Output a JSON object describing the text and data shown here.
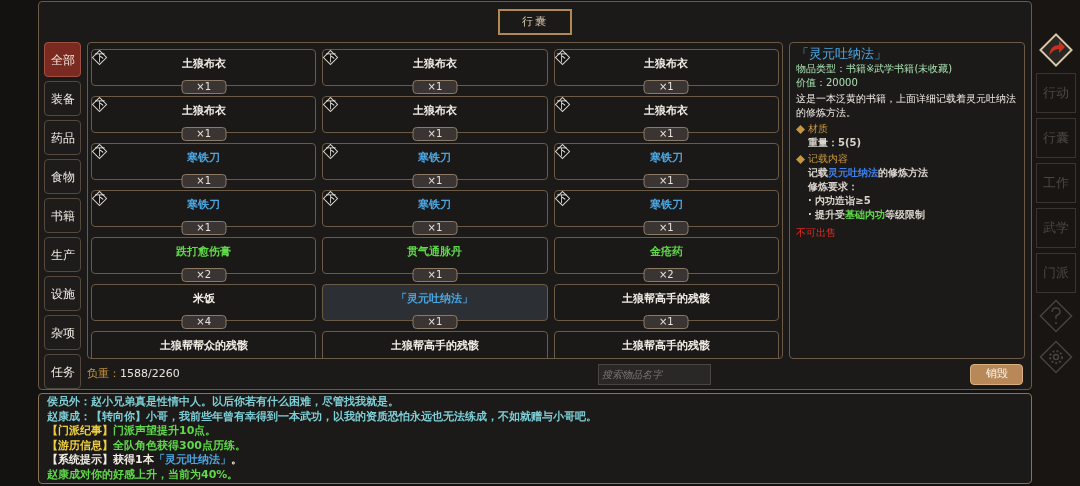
{
  "title": "行囊",
  "categories": [
    {
      "label": "全部",
      "selected": true
    },
    {
      "label": "装备",
      "selected": false
    },
    {
      "label": "药品",
      "selected": false
    },
    {
      "label": "食物",
      "selected": false
    },
    {
      "label": "书籍",
      "selected": false
    },
    {
      "label": "生产",
      "selected": false
    },
    {
      "label": "设施",
      "selected": false
    },
    {
      "label": "杂项",
      "selected": false
    },
    {
      "label": "任务",
      "selected": false
    }
  ],
  "items": [
    {
      "name": "土狼布衣",
      "count": "×1",
      "tag": "下",
      "color": "#f0ece4",
      "selected": false
    },
    {
      "name": "土狼布衣",
      "count": "×1",
      "tag": "下",
      "color": "#f0ece4",
      "selected": false
    },
    {
      "name": "土狼布衣",
      "count": "×1",
      "tag": "下",
      "color": "#f0ece4",
      "selected": false
    },
    {
      "name": "土狼布衣",
      "count": "×1",
      "tag": "下",
      "color": "#f0ece4",
      "selected": false
    },
    {
      "name": "土狼布衣",
      "count": "×1",
      "tag": "下",
      "color": "#f0ece4",
      "selected": false
    },
    {
      "name": "土狼布衣",
      "count": "×1",
      "tag": "下",
      "color": "#f0ece4",
      "selected": false
    },
    {
      "name": "寒铁刀",
      "count": "×1",
      "tag": "下",
      "color": "#4ba6e0",
      "selected": false
    },
    {
      "name": "寒铁刀",
      "count": "×1",
      "tag": "下",
      "color": "#4ba6e0",
      "selected": false
    },
    {
      "name": "寒铁刀",
      "count": "×1",
      "tag": "下",
      "color": "#4ba6e0",
      "selected": false
    },
    {
      "name": "寒铁刀",
      "count": "×1",
      "tag": "下",
      "color": "#4ba6e0",
      "selected": false
    },
    {
      "name": "寒铁刀",
      "count": "×1",
      "tag": "下",
      "color": "#4ba6e0",
      "selected": false
    },
    {
      "name": "寒铁刀",
      "count": "×1",
      "tag": "下",
      "color": "#4ba6e0",
      "selected": false
    },
    {
      "name": "跌打愈伤膏",
      "count": "×2",
      "color": "#5fd84a",
      "selected": false
    },
    {
      "name": "贯气通脉丹",
      "count": "×1",
      "color": "#5fd84a",
      "selected": false
    },
    {
      "name": "金疮药",
      "count": "×2",
      "color": "#5fd84a",
      "selected": false
    },
    {
      "name": "米饭",
      "count": "×4",
      "color": "#f0ece4",
      "selected": false
    },
    {
      "name": "「灵元吐纳法」",
      "count": "×1",
      "color": "#4ba6e0",
      "selected": true
    },
    {
      "name": "土狼帮高手的残骸",
      "count": "×1",
      "color": "#f0ece4",
      "selected": false
    },
    {
      "name": "土狼帮帮众的残骸",
      "color": "#f0ece4",
      "selected": false
    },
    {
      "name": "土狼帮高手的残骸",
      "color": "#f0ece4",
      "selected": false
    },
    {
      "name": "土狼帮高手的残骸",
      "color": "#f0ece4",
      "selected": false
    }
  ],
  "detail": {
    "title": "「灵元吐纳法」",
    "type": "物品类型：书籍※武学书籍(未收藏)",
    "value": "价值：20000",
    "description": "这是一本泛黄的书籍，上面详细记载着灵元吐纳法的修炼方法。",
    "sections": [
      {
        "heading": "材质",
        "lines": [
          [
            {
              "text": "重量：5(5)",
              "color": "#d8d4cc"
            }
          ]
        ]
      },
      {
        "heading": "记载内容",
        "lines": [
          [
            {
              "text": "记载",
              "color": "#d8d4cc"
            },
            {
              "text": "灵元吐纳法",
              "color": "#3f7fe8"
            },
            {
              "text": "的修炼方法",
              "color": "#d8d4cc"
            }
          ],
          [
            {
              "text": "修炼要求：",
              "color": "#d8d4cc"
            }
          ],
          [
            {
              "text": " · 内功造诣≥5",
              "color": "#d8d4cc"
            }
          ],
          [
            {
              "text": " · 提升受",
              "color": "#d8d4cc"
            },
            {
              "text": "基础内功",
              "color": "#5fd84a"
            },
            {
              "text": "等级限制",
              "color": "#d8d4cc"
            }
          ]
        ]
      }
    ],
    "note": "不可出售"
  },
  "weight": {
    "label": "负重：",
    "value": "1588/2260"
  },
  "search": {
    "placeholder": "搜索物品名字"
  },
  "destroy_button": "销毁",
  "log": [
    [
      {
        "text": "侯员外：赵小兄弟真是性情中人。以后你若有什么困难，尽管找我就是。",
        "color": "#7ccfd6"
      }
    ],
    [
      {
        "text": "赵康成：【转向你】小哥，我前些年曾有幸得到一本武功，以我的资质恐怕永远也无法练成，不如就赠与小哥吧。",
        "color": "#7ccfd6"
      }
    ],
    [
      {
        "text": "【门派纪事】",
        "color": "#f0d040"
      },
      {
        "text": "门派声望提升10点。",
        "color": "#5fd84a"
      }
    ],
    [
      {
        "text": "【游历信息】",
        "color": "#f0d040"
      },
      {
        "text": "全队角色获得300点历练。",
        "color": "#5fd84a"
      }
    ],
    [
      {
        "text": "【系统提示】获得1本",
        "color": "#f0ece4"
      },
      {
        "text": "「灵元吐纳法」",
        "color": "#4ba6e0"
      },
      {
        "text": "。"
      }
    ],
    [
      {
        "text": "赵康成对你的好感上升，当前为40%。",
        "color": "#5fd84a"
      }
    ]
  ],
  "side_menu": [
    {
      "kind": "back"
    },
    {
      "kind": "text",
      "label": "行动"
    },
    {
      "kind": "text",
      "label": "行囊"
    },
    {
      "kind": "text",
      "label": "工作"
    },
    {
      "kind": "text",
      "label": "武学"
    },
    {
      "kind": "text",
      "label": "门派"
    },
    {
      "kind": "help"
    },
    {
      "kind": "settings"
    }
  ]
}
